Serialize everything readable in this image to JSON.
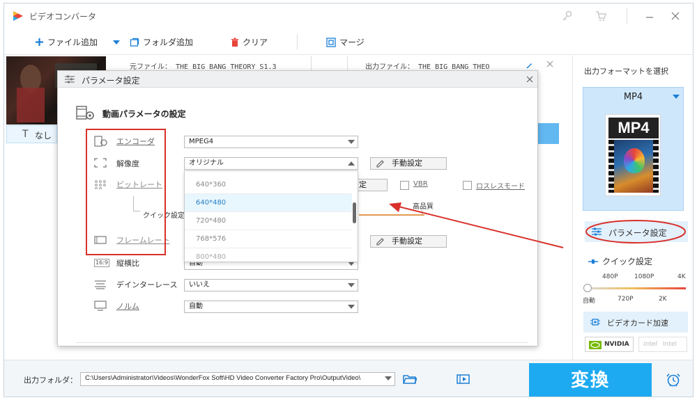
{
  "app": {
    "title": "ビデオコンバータ"
  },
  "toolbar": {
    "add_file": "ファイル追加",
    "add_folder": "フォルダ追加",
    "clear": "クリア",
    "merge": "マージ"
  },
  "file_row": {
    "source_file": "元ファイル： THE BIG BANG THEORY S1.3",
    "output_file": "出力ファイル： THE BIG BANG THEO",
    "subtitle": "なし"
  },
  "dialog": {
    "title": "パラメータ設定",
    "section_title": "動画パラメータの設定",
    "encoder_label": "エンコーダ",
    "encoder_value": "MPEG4",
    "resolution_label": "解像度",
    "resolution_value": "オリジナル",
    "manual_setting": "手動設定",
    "bitrate_label": "ビットレート",
    "vbr_label": "VBR",
    "lossless_label": "ロスレスモード",
    "quick_setting_label": "クイック設定",
    "high_quality": "高品質",
    "framerate_label": "フレームレート",
    "aspect_label": "縦横比",
    "aspect_value": "自動",
    "deinterlace_label": "デインターレース",
    "deinterlace_value": "いいえ",
    "norm_label": "ノルム",
    "norm_value": "自動",
    "dropdown_options": [
      "640*360",
      "640*480",
      "720*480",
      "768*576",
      "800*480"
    ],
    "dropdown_selected": "640*480"
  },
  "right_panel": {
    "output_format_title": "出力フォーマットを選択",
    "format_name": "MP4",
    "format_logo_text": "MP4",
    "parameter_setting": "パラメータ設定",
    "quick_setting": "クイック設定",
    "quality_top_labels": [
      "480P",
      "1080P",
      "4K"
    ],
    "quality_bottom_labels": [
      "自動",
      "720P",
      "2K"
    ],
    "gpu_accel": "ビデオカード加速",
    "nvidia": "NVIDIA",
    "intel": "Intel"
  },
  "footer": {
    "output_folder_label": "出力フォルダ：",
    "output_path": "C:\\Users\\Administrator\\Videos\\WonderFox Soft\\HD Video Converter Factory Pro\\OutputVideo\\",
    "convert": "変換"
  },
  "colors": {
    "accent": "#1eaaf1",
    "red": "#d9302b",
    "panel_blue": "#cfe7fb"
  }
}
